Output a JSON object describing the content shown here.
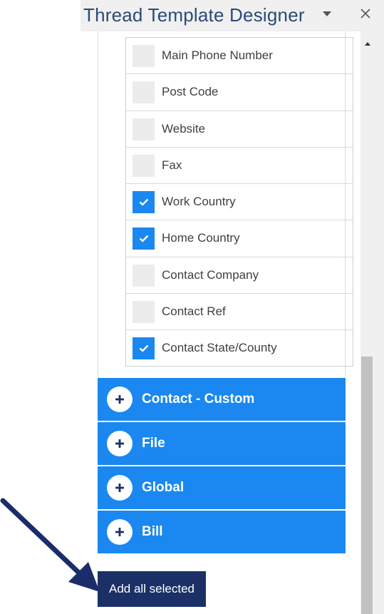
{
  "pane": {
    "title": "Thread Template Designer"
  },
  "fields": [
    {
      "label": "Main Phone Number",
      "checked": false
    },
    {
      "label": "Post Code",
      "checked": false
    },
    {
      "label": "Website",
      "checked": false
    },
    {
      "label": "Fax",
      "checked": false
    },
    {
      "label": "Work Country",
      "checked": true
    },
    {
      "label": "Home Country",
      "checked": true
    },
    {
      "label": "Contact Company",
      "checked": false
    },
    {
      "label": "Contact Ref",
      "checked": false
    },
    {
      "label": "Contact State/County",
      "checked": true
    }
  ],
  "sections": [
    {
      "label": "Contact - Custom"
    },
    {
      "label": "File"
    },
    {
      "label": "Global"
    },
    {
      "label": "Bill"
    }
  ],
  "actions": {
    "add_all_selected": "Add all selected"
  },
  "colors": {
    "accent": "#1a88f0",
    "button_dark": "#1b3067",
    "title": "#2b4a7a",
    "annotation_arrow": "#1b2c6b"
  },
  "icons": {
    "dropdown": "chevron-down-icon",
    "close": "close-icon",
    "checkbox_checked": "checkmark-icon",
    "section_expand": "plus-icon",
    "scroll_up": "scroll-up-icon"
  }
}
